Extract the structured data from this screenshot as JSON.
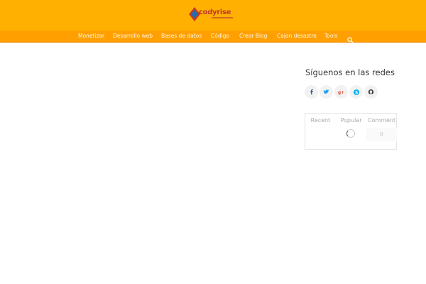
{
  "logo": {
    "text": "codyrise"
  },
  "nav": {
    "items": [
      {
        "label": "Monetizar"
      },
      {
        "label": "Desarrollo web"
      },
      {
        "label": "Bases de datos"
      },
      {
        "label": "Código"
      },
      {
        "label": "Crear Blog"
      },
      {
        "label": "Cajon desastre"
      },
      {
        "label": "Tools"
      }
    ],
    "search_icon": "search-icon"
  },
  "sidebar": {
    "social_title": "Síguenos en las redes",
    "social": [
      {
        "icon": "facebook-icon",
        "glyph": "f",
        "color": "#3b5998"
      },
      {
        "icon": "twitter-icon",
        "glyph": "t",
        "color": "#1da1f2"
      },
      {
        "icon": "google-plus-icon",
        "glyph": "g+",
        "color": "#dd4b39"
      },
      {
        "icon": "skype-icon",
        "glyph": "S",
        "color": "#00aff0"
      },
      {
        "icon": "github-icon",
        "glyph": "gh",
        "color": "#333333"
      }
    ],
    "tabs": [
      {
        "label": "Recent"
      },
      {
        "label": "Popular"
      },
      {
        "label": "Comment"
      }
    ],
    "comment_count": "0"
  },
  "colors": {
    "header": "#ffb000",
    "navbar": "#ffa000"
  }
}
